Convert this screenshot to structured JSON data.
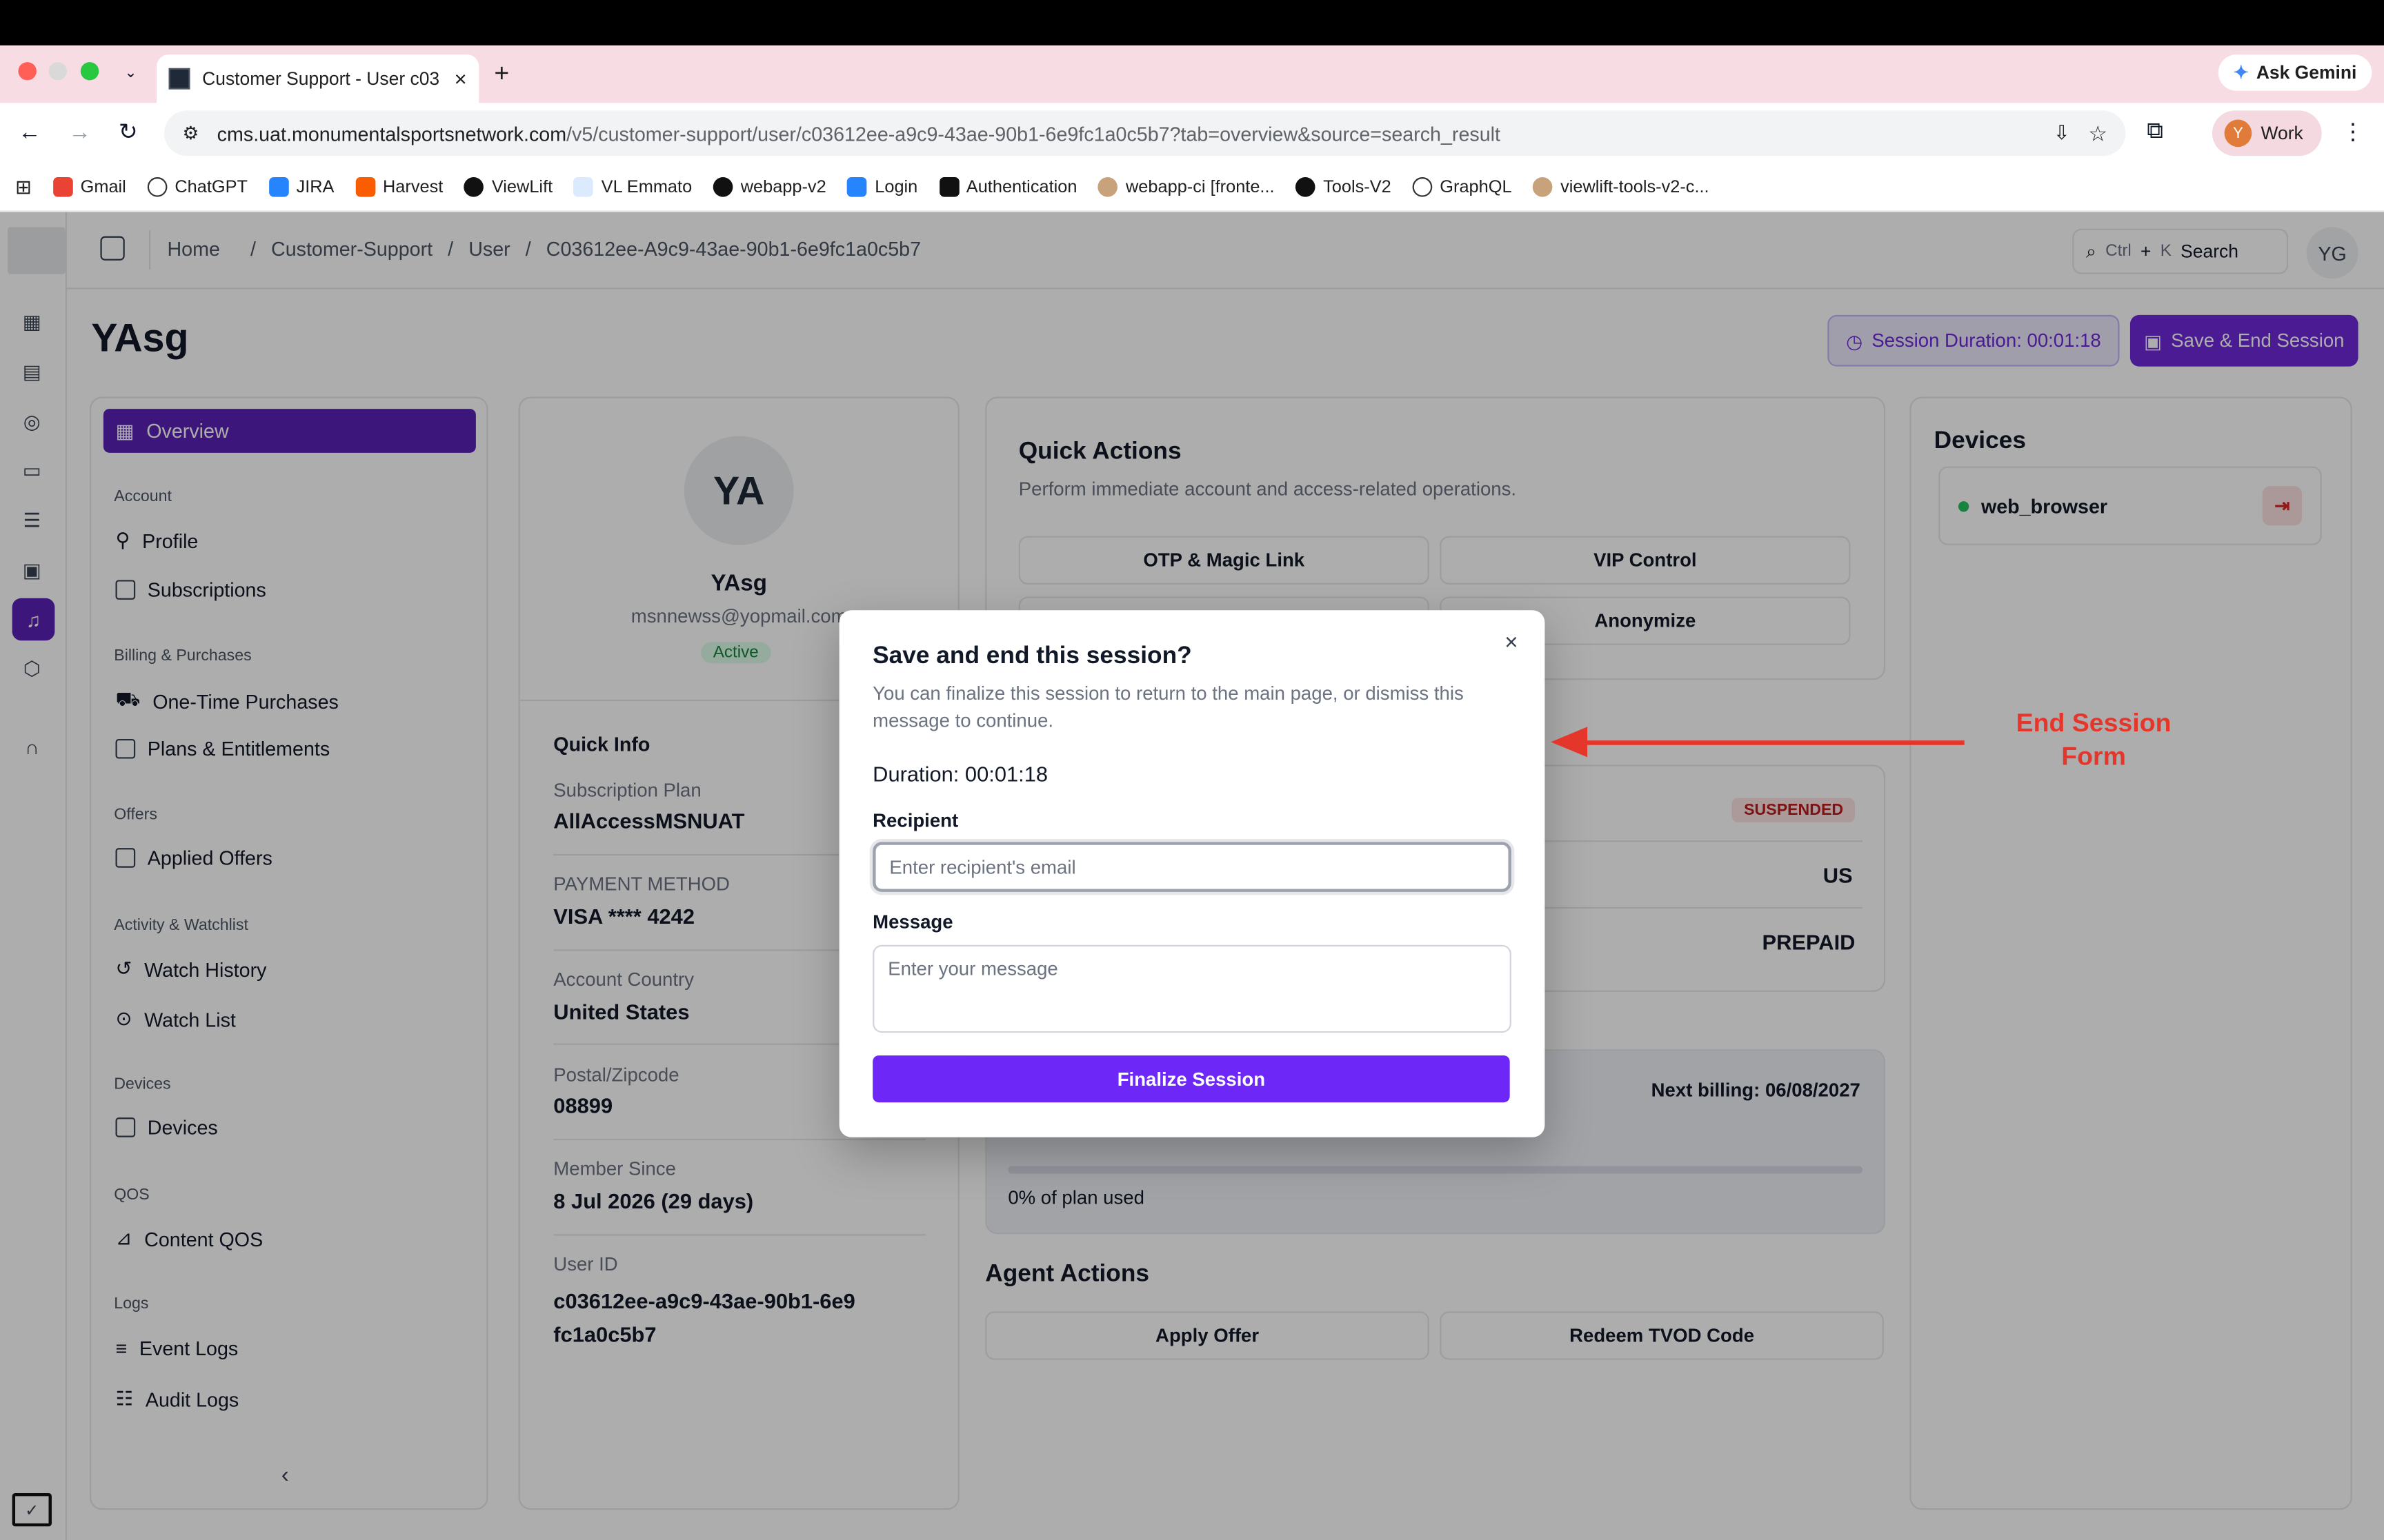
{
  "browser": {
    "tab_title": "Customer Support - User c03",
    "new_tab": "+",
    "tab_close": "×",
    "gemini_label": "Ask Gemini",
    "url_host": "cms.uat.monumentalsportsnetwork.com",
    "url_path": "/v5/customer-support/user/c03612ee-a9c9-43ae-90b1-6e9fc1a0c5b7?tab=overview&source=search_result",
    "profile_initial": "Y",
    "profile_label": "Work",
    "bookmarks": [
      "Gmail",
      "ChatGPT",
      "JIRA",
      "Harvest",
      "ViewLift",
      "VL Emmato",
      "webapp-v2",
      "Login",
      "Authentication",
      "webapp-ci [fronte...",
      "Tools-V2",
      "GraphQL",
      "viewlift-tools-v2-c..."
    ]
  },
  "header": {
    "breadcrumbs": [
      "Home",
      "/",
      "Customer-Support",
      "/",
      "User",
      "/",
      "C03612ee-A9c9-43ae-90b1-6e9fc1a0c5b7"
    ],
    "search_kbd_1": "Ctrl",
    "search_plus": "+",
    "search_kbd_2": "K",
    "search_label": "Search",
    "user_initials": "YG"
  },
  "page": {
    "title": "YAsg",
    "session_duration": "Session Duration:  00:01:18",
    "save_end": "Save & End Session"
  },
  "sidenav": {
    "overview": "Overview",
    "sections": [
      {
        "title": "Account",
        "items": [
          "Profile",
          "Subscriptions"
        ]
      },
      {
        "title": "Billing & Purchases",
        "items": [
          "One-Time Purchases",
          "Plans & Entitlements"
        ]
      },
      {
        "title": "Offers",
        "items": [
          "Applied Offers"
        ]
      },
      {
        "title": "Activity & Watchlist",
        "items": [
          "Watch History",
          "Watch List"
        ]
      },
      {
        "title": "Devices",
        "items": [
          "Devices"
        ]
      },
      {
        "title": "QOS",
        "items": [
          "Content QOS"
        ]
      },
      {
        "title": "Logs",
        "items": [
          "Event Logs",
          "Audit Logs"
        ]
      }
    ],
    "collapse": "‹"
  },
  "profile": {
    "initials": "YA",
    "name": "YAsg",
    "email": "msnnewss@yopmail.com",
    "status": "Active",
    "quick_info_title": "Quick Info",
    "fields": [
      {
        "label": "Subscription Plan",
        "value": "AllAccessMSNUAT"
      },
      {
        "label": "PAYMENT METHOD",
        "value": "VISA **** 4242"
      },
      {
        "label": "Account Country",
        "value": "United States"
      },
      {
        "label": "Postal/Zipcode",
        "value": "08899"
      },
      {
        "label": "Member Since",
        "value": "8 Jul 2026 (29 days)"
      },
      {
        "label": "User ID",
        "value": "c03612ee-a9c9-43ae-90b1-6e9fc1a0c5b7"
      }
    ]
  },
  "quick_actions": {
    "title": "Quick Actions",
    "subtitle": "Perform immediate account and access-related operations.",
    "buttons": [
      "OTP & Magic Link",
      "VIP Control",
      "Anonymize"
    ]
  },
  "account": {
    "badge": "SUSPENDED",
    "country": "US",
    "type": "PREPAID"
  },
  "plan": {
    "next_billing": "Next billing: 06/08/2027",
    "usage_text": "0% of plan used",
    "usage_fraction": 0
  },
  "agent_actions": {
    "title": "Agent Actions",
    "buttons": [
      "Apply Offer",
      "Redeem TVOD Code"
    ]
  },
  "devices": {
    "title": "Devices",
    "items": [
      {
        "name": "web_browser",
        "status_color": "#22c55e"
      }
    ]
  },
  "modal": {
    "title": "Save and end this session?",
    "description": "You can finalize this session to return to the main page, or dismiss this message to continue.",
    "close": "×",
    "duration": "Duration: 00:01:18",
    "recipient_label": "Recipient",
    "recipient_placeholder": "Enter recipient's email",
    "message_label": "Message",
    "message_placeholder": "Enter your message",
    "submit": "Finalize Session"
  },
  "annotation": {
    "text_line1": "End Session",
    "text_line2": "Form",
    "color": "#e5362b"
  },
  "colors": {
    "accent": "#6d28d9",
    "primary_button": "#6d28f7",
    "danger": "#dc2626"
  }
}
